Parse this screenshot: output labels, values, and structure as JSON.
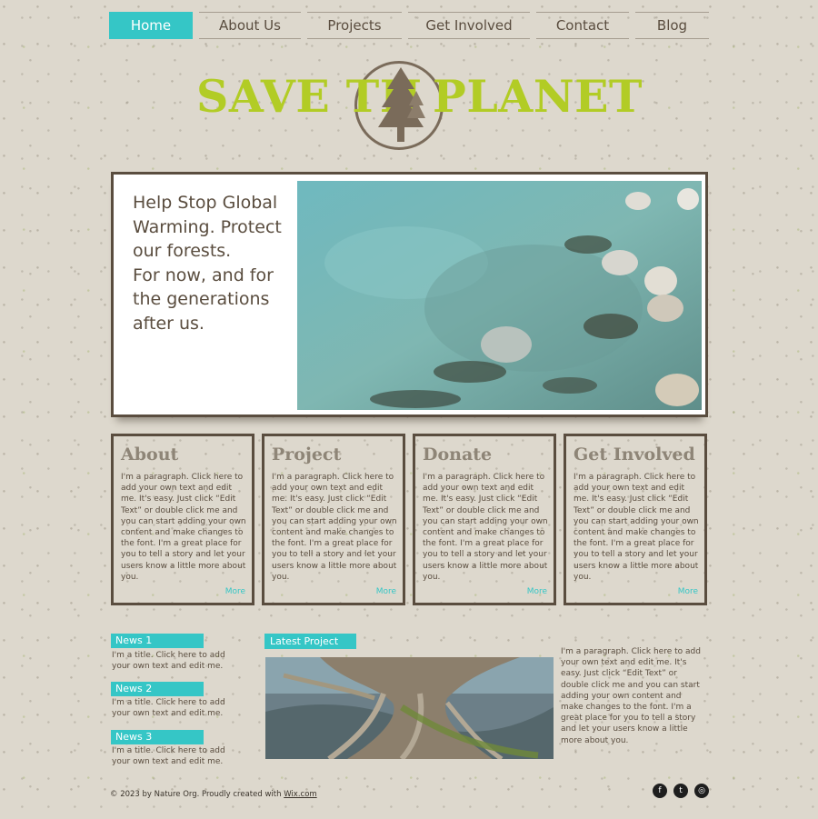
{
  "nav": {
    "items": [
      {
        "label": "Home",
        "active": true
      },
      {
        "label": "About Us"
      },
      {
        "label": "Projects"
      },
      {
        "label": "Get Involved"
      },
      {
        "label": "Contact"
      },
      {
        "label": "Blog"
      }
    ]
  },
  "logo": {
    "left": "SAVE TH",
    "right": "PLANET"
  },
  "hero": {
    "line1": "Help Stop Global Warming. Protect our forests.",
    "line2": "For now, and for the generations after us."
  },
  "cards": [
    {
      "title": "About",
      "text": "I'm a paragraph. Click here to add your own text and edit me. It's easy. Just click “Edit Text” or double click me and you can start adding your own content and make changes to the font. I'm a great place for you to tell a story and let your users know a little more about you.",
      "more": "More"
    },
    {
      "title": "Project",
      "text": "I'm a paragraph. Click here to add your own text and edit me. It's easy. Just click “Edit Text” or double click me and you can start adding your own content and make changes to the font. I'm a great place for you to tell a story and let your users know a little more about you.",
      "more": "More"
    },
    {
      "title": "Donate",
      "text": "I'm a paragraph. Click here to add your own text and edit me. It's easy. Just click “Edit Text” or double click me and you can start adding your own content and make changes to the font. I'm a great place for you to tell a story and let your users know a little more about you.",
      "more": "More"
    },
    {
      "title": "Get Involved",
      "text": "I'm a paragraph. Click here to add your own text and edit me. It's easy. Just click “Edit Text” or double click me and you can start adding your own content and make changes to the font. I'm a great place for you to tell a story and let your users know a little more about you.",
      "more": "More"
    }
  ],
  "news": [
    {
      "label": "News 1",
      "text": "I'm a title. Click here to add your own text and edit me."
    },
    {
      "label": "News 2",
      "text": "I'm a title. Click here to add your own text and edit me."
    },
    {
      "label": "News 3",
      "text": "I'm a title. Click here to add your own text and edit me."
    }
  ],
  "latest": {
    "label": "Latest Project",
    "text": "I'm a paragraph. Click here to add your own text and edit me. It's easy. Just click “Edit Text” or double click me and you can start adding your own content and make changes to the font. I'm a great place for you to tell a story and let your users know a little more about you."
  },
  "footer": {
    "text": "© 2023 by Nature Org. Proudly created with ",
    "link": "Wix.com"
  },
  "social": [
    {
      "icon": "facebook-icon",
      "glyph": "f"
    },
    {
      "icon": "twitter-icon",
      "glyph": "t"
    },
    {
      "icon": "instagram-icon",
      "glyph": "◎"
    }
  ],
  "colors": {
    "accent": "#35c6c6",
    "logo_green": "#b2cc25",
    "text_brown": "#5a4d3f"
  }
}
